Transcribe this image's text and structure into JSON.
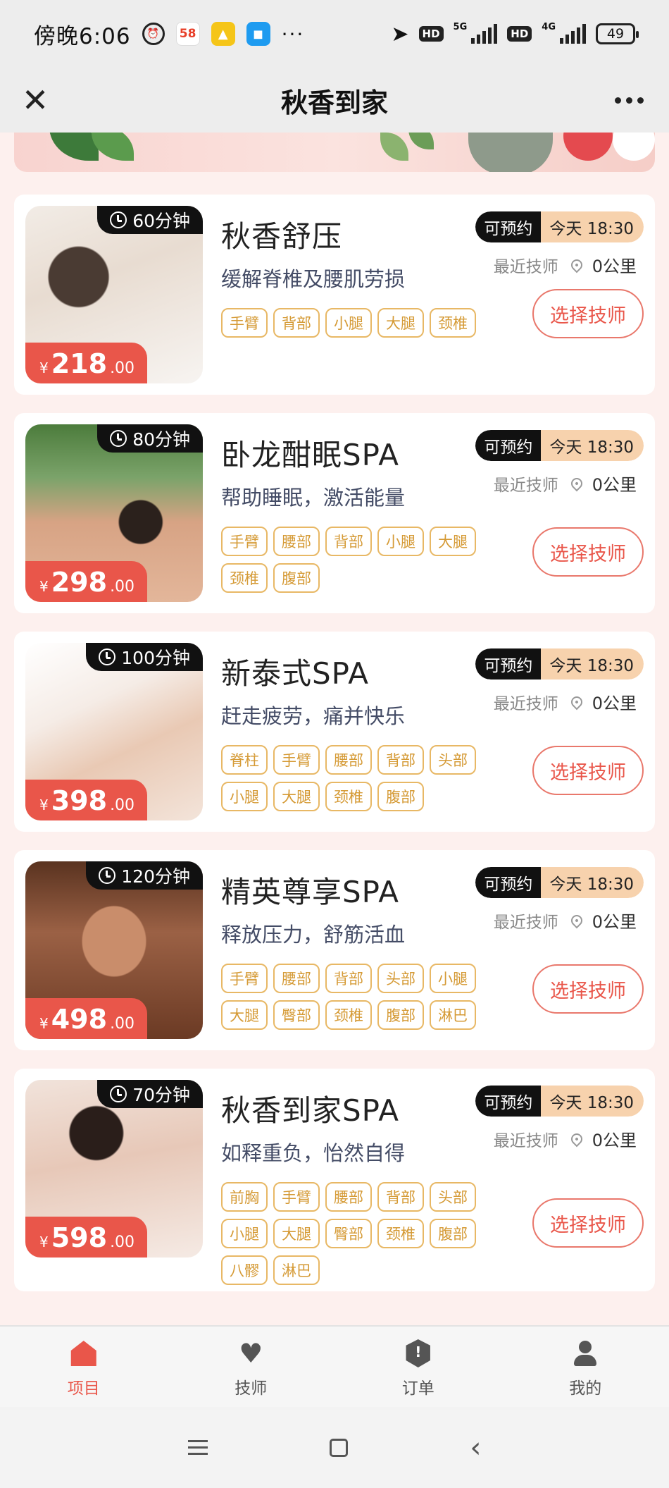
{
  "status_bar": {
    "time": "傍晚6:06",
    "icons": [
      "alarm-icon",
      "58-app-icon",
      "bird-app-icon",
      "blue-app-icon",
      "more-dots"
    ],
    "app_58_text": "58",
    "network_5g": "5G",
    "network_4g": "4G",
    "hd_label": "HD",
    "battery": "49"
  },
  "header": {
    "title": "秋香到家"
  },
  "colors": {
    "accent": "#e9564a",
    "tag_border": "#e8b865",
    "tag_text": "#d59a35",
    "avail_bg": "#111111",
    "avail_time_bg": "#f7d2ad",
    "page_bg": "#fdf0ee"
  },
  "services": [
    {
      "title": "秋香舒压",
      "subtitle": "缓解脊椎及腰肌劳损",
      "duration": "60分钟",
      "price_int": "218",
      "price_dec": ".00",
      "currency": "¥",
      "avail_label": "可预约",
      "avail_time": "今天 18:30",
      "nearest_label": "最近技师",
      "distance": "0公里",
      "button": "选择技师",
      "tags": [
        "手臂",
        "背部",
        "小腿",
        "大腿",
        "颈椎"
      ]
    },
    {
      "title": "卧龙酣眠SPA",
      "subtitle": "帮助睡眠，激活能量",
      "duration": "80分钟",
      "price_int": "298",
      "price_dec": ".00",
      "currency": "¥",
      "avail_label": "可预约",
      "avail_time": "今天 18:30",
      "nearest_label": "最近技师",
      "distance": "0公里",
      "button": "选择技师",
      "tags": [
        "手臂",
        "腰部",
        "背部",
        "小腿",
        "大腿",
        "颈椎",
        "腹部"
      ]
    },
    {
      "title": "新泰式SPA",
      "subtitle": "赶走疲劳，痛并快乐",
      "duration": "100分钟",
      "price_int": "398",
      "price_dec": ".00",
      "currency": "¥",
      "avail_label": "可预约",
      "avail_time": "今天 18:30",
      "nearest_label": "最近技师",
      "distance": "0公里",
      "button": "选择技师",
      "tags": [
        "脊柱",
        "手臂",
        "腰部",
        "背部",
        "头部",
        "小腿",
        "大腿",
        "颈椎",
        "腹部"
      ]
    },
    {
      "title": "精英尊享SPA",
      "subtitle": "释放压力，舒筋活血",
      "duration": "120分钟",
      "price_int": "498",
      "price_dec": ".00",
      "currency": "¥",
      "avail_label": "可预约",
      "avail_time": "今天 18:30",
      "nearest_label": "最近技师",
      "distance": "0公里",
      "button": "选择技师",
      "tags": [
        "手臂",
        "腰部",
        "背部",
        "头部",
        "小腿",
        "大腿",
        "臀部",
        "颈椎",
        "腹部",
        "淋巴"
      ]
    },
    {
      "title": "秋香到家SPA",
      "subtitle": "如释重负，怡然自得",
      "duration": "70分钟",
      "price_int": "598",
      "price_dec": ".00",
      "currency": "¥",
      "avail_label": "可预约",
      "avail_time": "今天 18:30",
      "nearest_label": "最近技师",
      "distance": "0公里",
      "button": "选择技师",
      "tags": [
        "前胸",
        "手臂",
        "腰部",
        "背部",
        "头部",
        "小腿",
        "大腿",
        "臀部",
        "颈椎",
        "腹部",
        "八髎",
        "淋巴"
      ]
    }
  ],
  "tabbar": {
    "tabs": [
      {
        "label": "项目",
        "icon": "home-icon",
        "active": true
      },
      {
        "label": "技师",
        "icon": "heart-icon",
        "active": false
      },
      {
        "label": "订单",
        "icon": "shield-icon",
        "active": false
      },
      {
        "label": "我的",
        "icon": "user-icon",
        "active": false
      }
    ]
  }
}
